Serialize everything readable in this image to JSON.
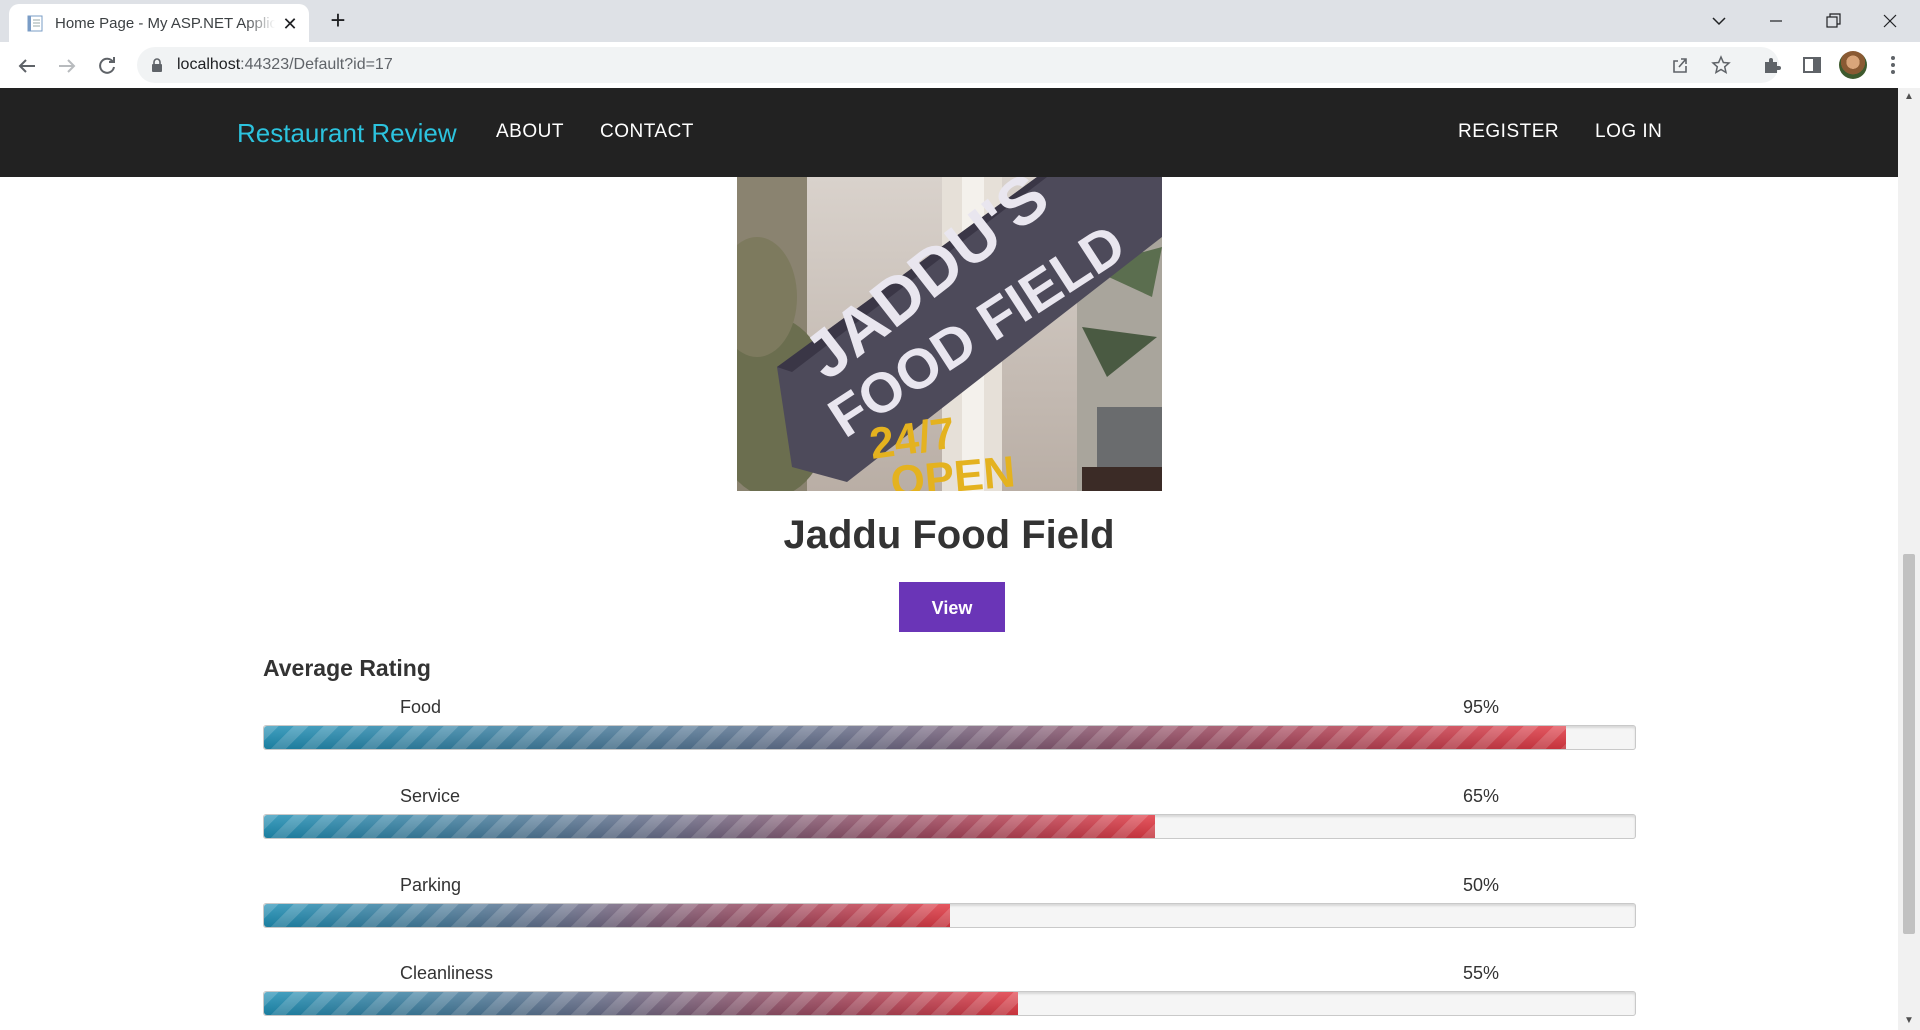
{
  "browser": {
    "tab_title": "Home Page - My ASP.NET Application",
    "close_symbol": "✕",
    "new_tab_symbol": "+",
    "url_host": "localhost",
    "url_rest": ":44323/Default?id=17",
    "icons": [
      "back-icon",
      "forward-icon",
      "reload-icon",
      "lock-icon",
      "share-icon",
      "star-icon",
      "extensions-icon",
      "side-panel-icon",
      "avatar",
      "menu-icon"
    ]
  },
  "site": {
    "brand": "Restaurant Review",
    "brand_color": "#2cc3de",
    "nav_left": [
      "ABOUT",
      "CONTACT"
    ],
    "nav_right": [
      "REGISTER",
      "LOG IN"
    ]
  },
  "restaurant": {
    "sign_text": [
      "JADDU'S",
      "FOOD FIELD",
      "24/7",
      "OPEN"
    ],
    "name": "Jaddu Food Field",
    "view_label": "View",
    "view_color": "#6a35b7"
  },
  "ratings": {
    "title": "Average Rating",
    "items": [
      {
        "label": "Food",
        "percent_text": "95%",
        "value": 95
      },
      {
        "label": "Service",
        "percent_text": "65%",
        "value": 65
      },
      {
        "label": "Parking",
        "percent_text": "50%",
        "value": 50
      },
      {
        "label": "Cleanliness",
        "percent_text": "55%",
        "value": 55
      }
    ]
  }
}
